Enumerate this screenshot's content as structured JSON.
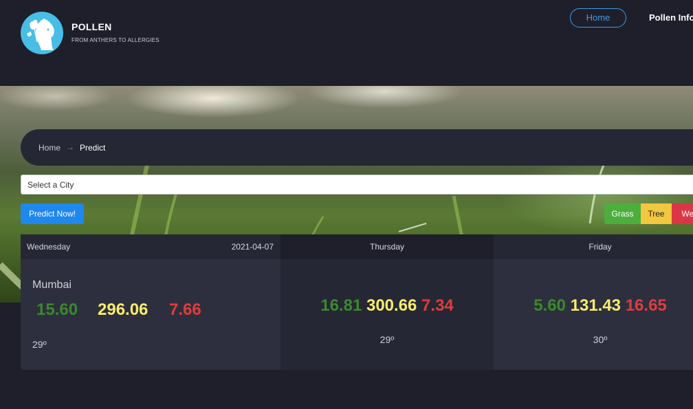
{
  "brand": {
    "name": "POLLEN",
    "tagline": "FROM ANTHERS TO ALLERGIES"
  },
  "nav": {
    "home": "Home",
    "pollen_info": "Pollen Info"
  },
  "breadcrumb": {
    "home": "Home",
    "arrow": "→",
    "current": "Predict"
  },
  "city_select": {
    "placeholder": "Select a City"
  },
  "predict_button": "Predict Now!",
  "legend": {
    "grass": "Grass",
    "tree": "Tree",
    "weed": "Weed"
  },
  "colors": {
    "grass": "#4caf3c",
    "tree": "#f3c73f",
    "weed": "#dc3545",
    "accent": "#1e88ef"
  },
  "forecast": [
    {
      "day": "Wednesday",
      "date": "2021-04-07",
      "city": "Mumbai",
      "grass": "15.60",
      "tree": "296.06",
      "weed": "7.66",
      "temp": "29º"
    },
    {
      "day": "Thursday",
      "grass": "16.81",
      "tree": "300.66",
      "weed": "7.34",
      "temp": "29º"
    },
    {
      "day": "Friday",
      "grass": "5.60",
      "tree": "131.43",
      "weed": "16.65",
      "temp": "30º"
    }
  ]
}
